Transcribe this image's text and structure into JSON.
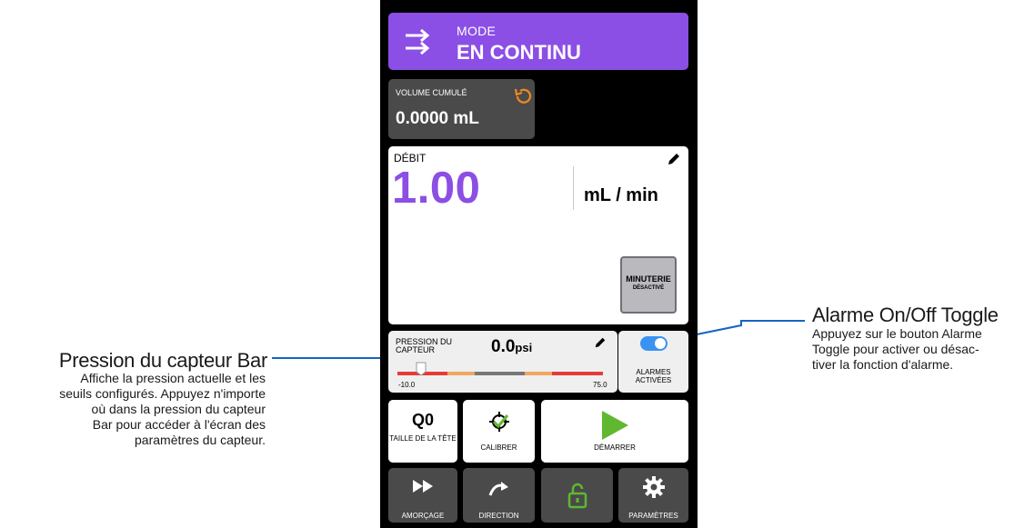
{
  "mode": {
    "label": "MODE",
    "value": "EN CONTINU",
    "color": "#8b4fe6"
  },
  "volume": {
    "label": "VOLUME CUMULÉ",
    "value": "0.0000 mL",
    "reset_icon": "reset-icon",
    "icon_color": "#f08a24"
  },
  "flow": {
    "label": "DÉBIT",
    "value": "1.00",
    "unit": "mL / min",
    "value_color": "#8b4fe6",
    "edit_icon": "pencil-icon"
  },
  "timer": {
    "label": "MINUTERIE",
    "state": "DÉSACTIVÉ"
  },
  "pressure": {
    "label": "PRESSION DU CAPTEUR",
    "value": "0.0",
    "unit": "psi",
    "min": "-10.0",
    "max": "75.0",
    "current": 0.0,
    "edit_icon": "pencil-icon"
  },
  "alarm": {
    "label": "ALARMES ACTIVÉES",
    "enabled": true,
    "toggle_color": "#3a93f0"
  },
  "head": {
    "value": "Q0",
    "label": "TAILLE DE LA TÊTE"
  },
  "calibrate": {
    "label": "CALIBRER",
    "icon": "calibrate-icon",
    "icon_color": "#5fb830"
  },
  "start": {
    "label": "DÉMARRER",
    "icon": "play-icon",
    "icon_color": "#5fb830"
  },
  "bottom_nav": {
    "prime": {
      "label": "AMORÇAGE",
      "icon": "fast-forward-icon"
    },
    "direction": {
      "label": "DIRECTION",
      "icon": "curved-arrow-icon"
    },
    "lock": {
      "icon": "unlock-icon",
      "icon_color": "#5fb830"
    },
    "settings": {
      "label": "PARAMÈTRES",
      "icon": "gear-icon"
    }
  },
  "annotations": {
    "pressure": {
      "title": "Pression du capteur Bar",
      "lines": [
        "Affiche la pression actuelle et les",
        "seuils configurés. Appuyez n'importe",
        "où dans la pression du capteur",
        "Bar pour accéder à l'écran des",
        "paramètres du capteur."
      ]
    },
    "alarm": {
      "title": "Alarme On/Off Toggle",
      "lines": [
        "Appuyez sur le bouton Alarme",
        "Toggle pour activer ou désac-",
        "tiver la fonction d'alarme."
      ]
    },
    "line_color": "#1565c0"
  }
}
